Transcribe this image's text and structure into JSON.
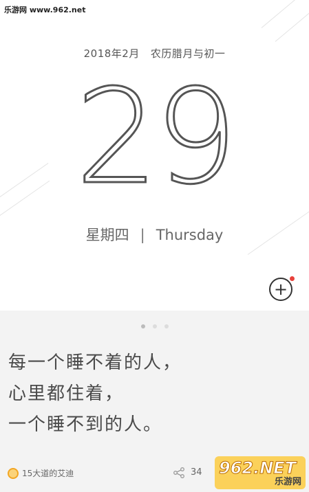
{
  "watermark": "乐游网 www.962.net",
  "date": {
    "year_month": "2018年2月",
    "lunar": "农历腊月与初一",
    "day": "29",
    "weekday_cn": "星期四",
    "separator": "|",
    "weekday_en": "Thursday"
  },
  "actions": {
    "add_symbol": "+",
    "notification_color": "#e8413b"
  },
  "pager": {
    "count": 3,
    "active_index": 0
  },
  "quote": {
    "lines": [
      "每一个睡不着的人，",
      "心里都住着，",
      "一个睡不到的人。"
    ]
  },
  "footer": {
    "author": "15大道的艾迪",
    "share_count": "34"
  },
  "badge": {
    "logo": "962.NET",
    "sub": "乐游网"
  },
  "colors": {
    "quote_background": "#f3f3f3",
    "accent_badge": "#fbd15a"
  }
}
